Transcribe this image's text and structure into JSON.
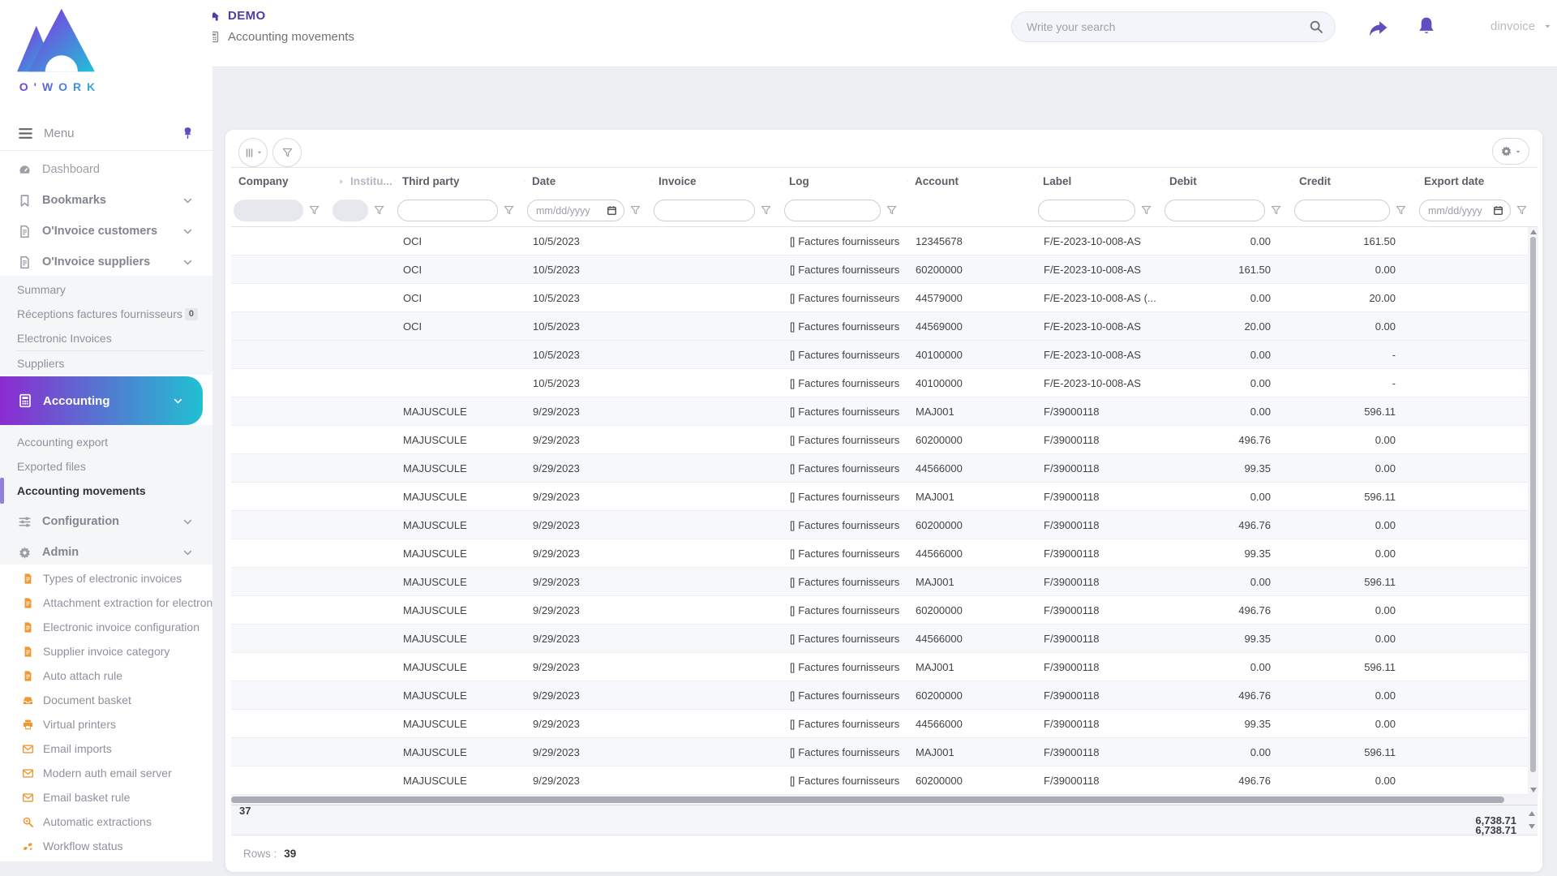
{
  "brand": {
    "logo_text": "O'WORK"
  },
  "topbar": {
    "app_name": "DEMO",
    "page_title": "Accounting movements",
    "search_placeholder": "Write your search",
    "username": "dinvoice"
  },
  "sidebar": {
    "menu_label": "Menu",
    "top_items": [
      {
        "icon": "dashboard",
        "label": "Dashboard",
        "chevron": false,
        "bold": false
      },
      {
        "icon": "bookmark",
        "label": "Bookmarks",
        "chevron": true,
        "bold": true
      },
      {
        "icon": "invoice-doc",
        "label": "O'Invoice customers",
        "chevron": true,
        "bold": true
      },
      {
        "icon": "invoice-doc",
        "label": "O'Invoice suppliers",
        "chevron": true,
        "bold": true
      }
    ],
    "suppliers_submenu": [
      {
        "label": "Summary"
      },
      {
        "label": "Réceptions factures fournisseurs",
        "badge": "0"
      },
      {
        "label": "Electronic Invoices",
        "divider_after": true
      },
      {
        "label": "Suppliers"
      }
    ],
    "accounting": {
      "label": "Accounting"
    },
    "accounting_submenu": [
      {
        "label": "Accounting export"
      },
      {
        "label": "Exported files"
      },
      {
        "label": "Accounting movements",
        "active": true
      }
    ],
    "config_item": {
      "label": "Configuration"
    },
    "admin_item": {
      "label": "Admin"
    },
    "admin_submenu": [
      {
        "icon": "doc",
        "label": "Types of electronic invoices"
      },
      {
        "icon": "doc",
        "label": "Attachment extraction for electroni"
      },
      {
        "icon": "doc",
        "label": "Electronic invoice configuration"
      },
      {
        "icon": "doc",
        "label": "Supplier invoice category"
      },
      {
        "icon": "doc",
        "label": "Auto attach rule"
      },
      {
        "icon": "inbox",
        "label": "Document basket"
      },
      {
        "icon": "printer",
        "label": "Virtual printers"
      },
      {
        "icon": "envelope",
        "label": "Email imports"
      },
      {
        "icon": "envelope",
        "label": "Modern auth email server"
      },
      {
        "icon": "envelope",
        "label": "Email basket rule"
      },
      {
        "icon": "search-plus",
        "label": "Automatic extractions"
      },
      {
        "icon": "steps",
        "label": "Workflow status"
      }
    ]
  },
  "grid": {
    "columns": [
      "Company",
      "Institu...",
      "Third party",
      "Date",
      "Invoice",
      "Log",
      "Account",
      "Label",
      "Debit",
      "Credit",
      "Export date"
    ],
    "date_placeholder": "mm/dd/yyyy",
    "log_icon_placeholder": "[]",
    "rows": [
      {
        "third_party": "OCI",
        "date": "10/5/2023",
        "log": "Factures fournisseurs",
        "account": "12345678",
        "label": "F/E-2023-10-008-AS",
        "debit": "0.00",
        "credit": "161.50"
      },
      {
        "third_party": "OCI",
        "date": "10/5/2023",
        "log": "Factures fournisseurs",
        "account": "60200000",
        "label": "F/E-2023-10-008-AS",
        "debit": "161.50",
        "credit": "0.00"
      },
      {
        "third_party": "OCI",
        "date": "10/5/2023",
        "log": "Factures fournisseurs",
        "account": "44579000",
        "label": "F/E-2023-10-008-AS (...",
        "debit": "0.00",
        "credit": "20.00"
      },
      {
        "third_party": "OCI",
        "date": "10/5/2023",
        "log": "Factures fournisseurs",
        "account": "44569000",
        "label": "F/E-2023-10-008-AS",
        "debit": "20.00",
        "credit": "0.00"
      },
      {
        "third_party": "",
        "date": "10/5/2023",
        "log": "Factures fournisseurs",
        "account": "40100000",
        "label": "F/E-2023-10-008-AS",
        "debit": "0.00",
        "credit": "-"
      },
      {
        "third_party": "",
        "date": "10/5/2023",
        "log": "Factures fournisseurs",
        "account": "40100000",
        "label": "F/E-2023-10-008-AS",
        "debit": "0.00",
        "credit": "-"
      },
      {
        "third_party": "MAJUSCULE",
        "date": "9/29/2023",
        "log": "Factures fournisseurs",
        "account": "MAJ001",
        "label": "F/39000118",
        "debit": "0.00",
        "credit": "596.11"
      },
      {
        "third_party": "MAJUSCULE",
        "date": "9/29/2023",
        "log": "Factures fournisseurs",
        "account": "60200000",
        "label": "F/39000118",
        "debit": "496.76",
        "credit": "0.00"
      },
      {
        "third_party": "MAJUSCULE",
        "date": "9/29/2023",
        "log": "Factures fournisseurs",
        "account": "44566000",
        "label": "F/39000118",
        "debit": "99.35",
        "credit": "0.00"
      },
      {
        "third_party": "MAJUSCULE",
        "date": "9/29/2023",
        "log": "Factures fournisseurs",
        "account": "MAJ001",
        "label": "F/39000118",
        "debit": "0.00",
        "credit": "596.11"
      },
      {
        "third_party": "MAJUSCULE",
        "date": "9/29/2023",
        "log": "Factures fournisseurs",
        "account": "60200000",
        "label": "F/39000118",
        "debit": "496.76",
        "credit": "0.00"
      },
      {
        "third_party": "MAJUSCULE",
        "date": "9/29/2023",
        "log": "Factures fournisseurs",
        "account": "44566000",
        "label": "F/39000118",
        "debit": "99.35",
        "credit": "0.00"
      },
      {
        "third_party": "MAJUSCULE",
        "date": "9/29/2023",
        "log": "Factures fournisseurs",
        "account": "MAJ001",
        "label": "F/39000118",
        "debit": "0.00",
        "credit": "596.11"
      },
      {
        "third_party": "MAJUSCULE",
        "date": "9/29/2023",
        "log": "Factures fournisseurs",
        "account": "60200000",
        "label": "F/39000118",
        "debit": "496.76",
        "credit": "0.00"
      },
      {
        "third_party": "MAJUSCULE",
        "date": "9/29/2023",
        "log": "Factures fournisseurs",
        "account": "44566000",
        "label": "F/39000118",
        "debit": "99.35",
        "credit": "0.00"
      },
      {
        "third_party": "MAJUSCULE",
        "date": "9/29/2023",
        "log": "Factures fournisseurs",
        "account": "MAJ001",
        "label": "F/39000118",
        "debit": "0.00",
        "credit": "596.11"
      },
      {
        "third_party": "MAJUSCULE",
        "date": "9/29/2023",
        "log": "Factures fournisseurs",
        "account": "60200000",
        "label": "F/39000118",
        "debit": "496.76",
        "credit": "0.00"
      },
      {
        "third_party": "MAJUSCULE",
        "date": "9/29/2023",
        "log": "Factures fournisseurs",
        "account": "44566000",
        "label": "F/39000118",
        "debit": "99.35",
        "credit": "0.00"
      },
      {
        "third_party": "MAJUSCULE",
        "date": "9/29/2023",
        "log": "Factures fournisseurs",
        "account": "MAJ001",
        "label": "F/39000118",
        "debit": "0.00",
        "credit": "596.11"
      },
      {
        "third_party": "MAJUSCULE",
        "date": "9/29/2023",
        "log": "Factures fournisseurs",
        "account": "60200000",
        "label": "F/39000118",
        "debit": "496.76",
        "credit": "0.00"
      }
    ],
    "summary": {
      "third_party_count": "37",
      "debit_total": "6,738.71",
      "credit_total": "6,738.71"
    },
    "footer": {
      "rows_label": "Rows :",
      "rows_value": "39"
    }
  },
  "colors": {
    "accent_purple": "#5d4fc0",
    "gradient_start": "#8b2bd0",
    "gradient_end": "#21c0d2",
    "admin_icon_orange": "#ef9733"
  }
}
